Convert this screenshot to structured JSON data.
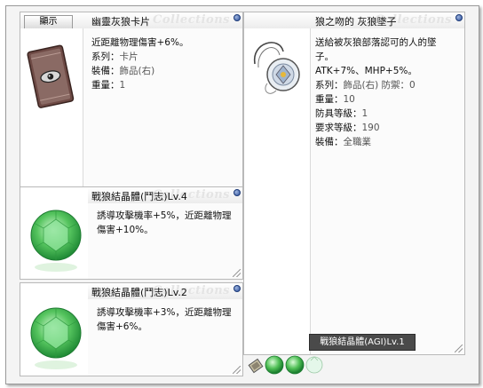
{
  "card_window": {
    "show_button": "顯示",
    "title": "幽靈灰狼卡片",
    "watermark": "Collections",
    "description": "近距離物理傷害+6%。",
    "props": [
      {
        "key": "系列：",
        "value": "卡片"
      },
      {
        "key": "裝備：",
        "value": "飾品(右)"
      },
      {
        "key": "重量：",
        "value": "1"
      }
    ]
  },
  "pendant_window": {
    "title": "狼之吻的 灰狼墜子",
    "watermark": "Collections",
    "description_lines": [
      "送給被灰狼部落認可的人的墜",
      "子。"
    ],
    "stats": "ATK+7%、MHP+5%。",
    "props": [
      {
        "key": "系列：",
        "value": "飾品(右) 防禦：0"
      },
      {
        "key": "重量：",
        "value": "10"
      },
      {
        "key": "防具等級：",
        "value": "1"
      },
      {
        "key": "要求等級：",
        "value": "190"
      },
      {
        "key": "裝備：",
        "value": "全職業"
      }
    ]
  },
  "crystal_window_1": {
    "title": "戰狼結晶體(鬥志)Lv.4",
    "watermark": "Collections",
    "description_lines": [
      "誘導攻擊機率+5%，近距離物理",
      "傷害+10%。"
    ]
  },
  "crystal_window_2": {
    "title": "戰狼結晶體(鬥志)Lv.2",
    "watermark": "Collections",
    "description_lines": [
      "誘導攻擊機率+3%，近距離物理",
      "傷害+6%。"
    ]
  },
  "tooltip": "戰狼結晶體(AGI)Lv.1",
  "colors": {
    "close_button": "#2c4f9a",
    "gem_green": "#4fc45a",
    "tooltip_bg": "#4a4a4a"
  }
}
